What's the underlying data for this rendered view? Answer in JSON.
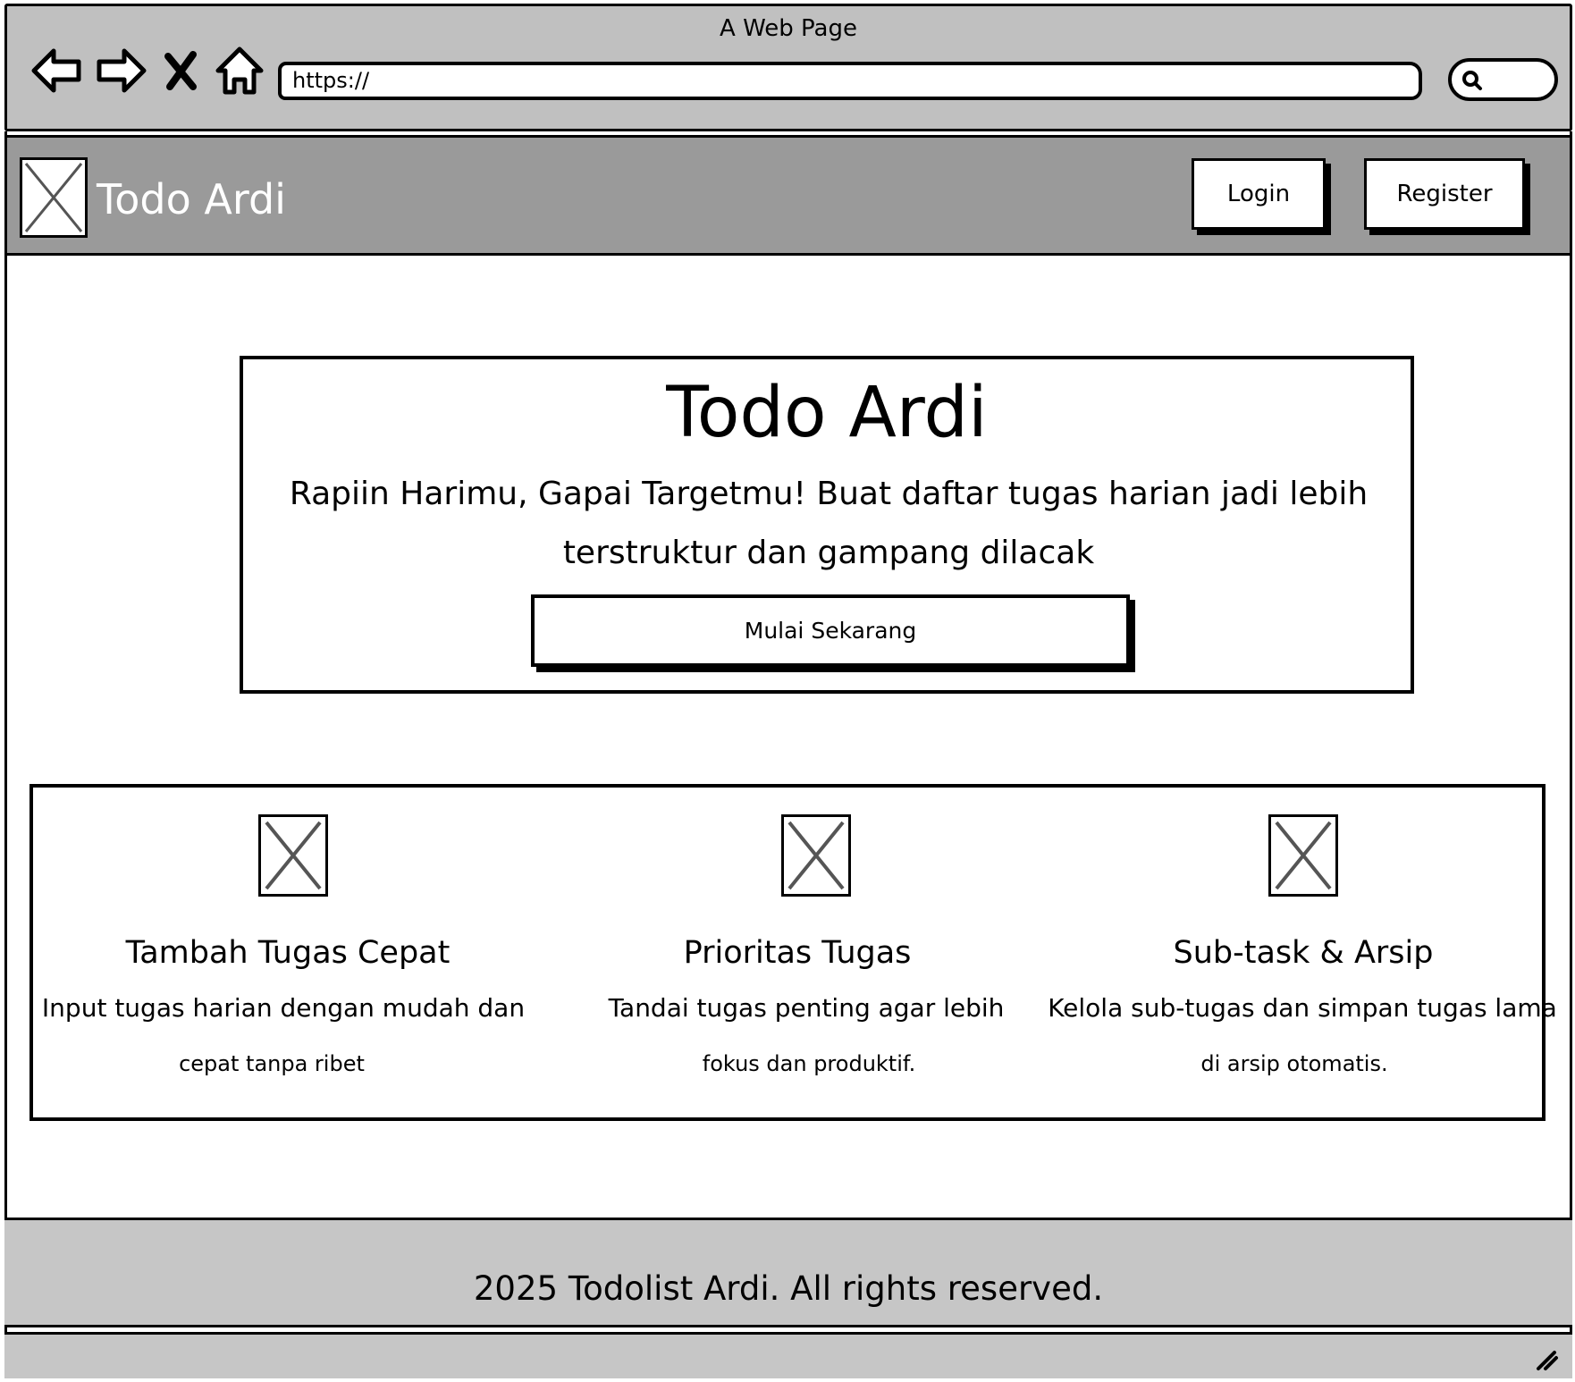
{
  "browser": {
    "window_title": "A Web Page",
    "url": "https://"
  },
  "header": {
    "brand": "Todo Ardi",
    "login_label": "Login",
    "register_label": "Register"
  },
  "hero": {
    "title": "Todo Ardi",
    "subtitle_line1": "Rapiin Harimu, Gapai Targetmu! Buat daftar tugas harian jadi lebih",
    "subtitle_line2": "terstruktur dan gampang dilacak",
    "cta_label": "Mulai Sekarang"
  },
  "features": [
    {
      "title": "Tambah Tugas Cepat",
      "desc_line1": "Input tugas harian dengan mudah dan",
      "desc_line2": "cepat tanpa ribet"
    },
    {
      "title": "Prioritas Tugas",
      "desc_line1": "Tandai tugas penting agar lebih",
      "desc_line2": "fokus dan produktif."
    },
    {
      "title": "Sub-task & Arsip",
      "desc_line1": "Kelola sub-tugas dan simpan tugas lama",
      "desc_line2": "di arsip otomatis."
    }
  ],
  "footer": {
    "text": "2025 Todolist Ardi. All rights reserved."
  },
  "icons": {
    "back": "back-arrow-icon",
    "forward": "forward-arrow-icon",
    "stop": "close-icon",
    "home": "home-icon",
    "search": "search-icon",
    "image_placeholder": "image-placeholder-icon",
    "resize": "resize-grip-icon"
  }
}
